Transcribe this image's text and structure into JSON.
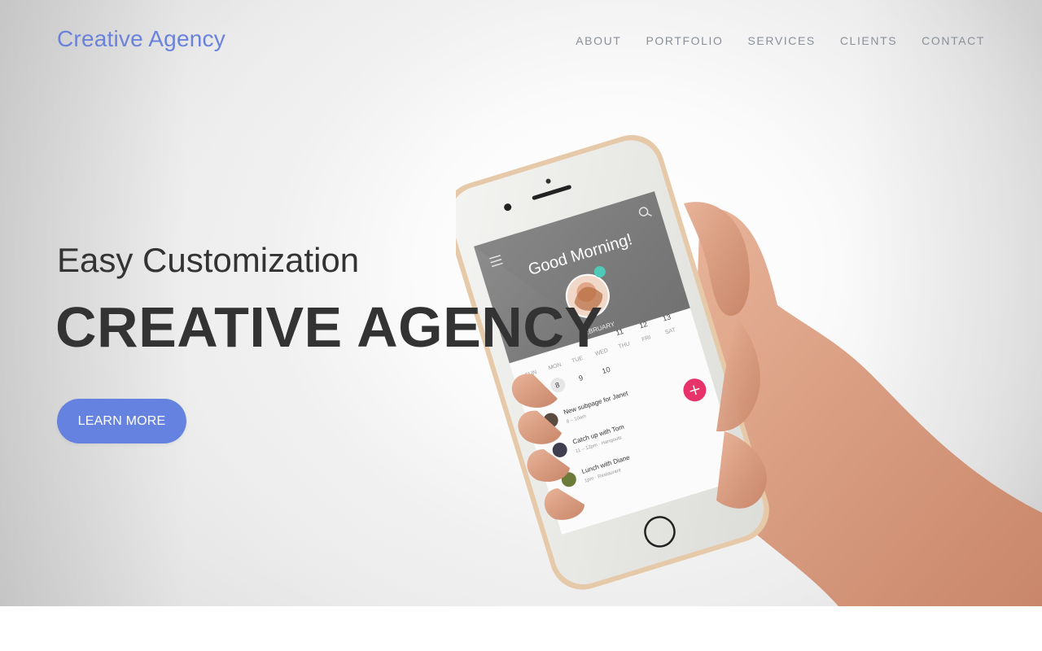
{
  "brand": {
    "name": "Creative Agency",
    "accent": "#6582e0"
  },
  "nav": {
    "items": [
      {
        "label": "ABOUT"
      },
      {
        "label": "PORTFOLIO"
      },
      {
        "label": "SERVICES"
      },
      {
        "label": "CLIENTS"
      },
      {
        "label": "CONTACT"
      }
    ]
  },
  "hero": {
    "subtitle": "Easy Customization",
    "title": "CREATIVE AGENCY",
    "cta_label": "LEARN MORE"
  },
  "phone_screen": {
    "greeting": "Good Morning!",
    "month": "FEBRUARY",
    "weekdays": [
      "SUN",
      "MON",
      "TUE",
      "WED",
      "THU",
      "FRI",
      "SAT"
    ],
    "dates_row1": [
      "",
      "",
      "",
      "",
      "11",
      "12",
      "13"
    ],
    "dates_row2": [
      "7",
      "8",
      "9",
      "10"
    ],
    "events": [
      {
        "title": "New subpage for Janet",
        "detail": "8 – 10am"
      },
      {
        "title": "Catch up with Tom",
        "detail": "11 – 12pm · Hangouts"
      },
      {
        "title": "Lunch with Diane",
        "detail": "1pm · Restaurant"
      }
    ]
  }
}
